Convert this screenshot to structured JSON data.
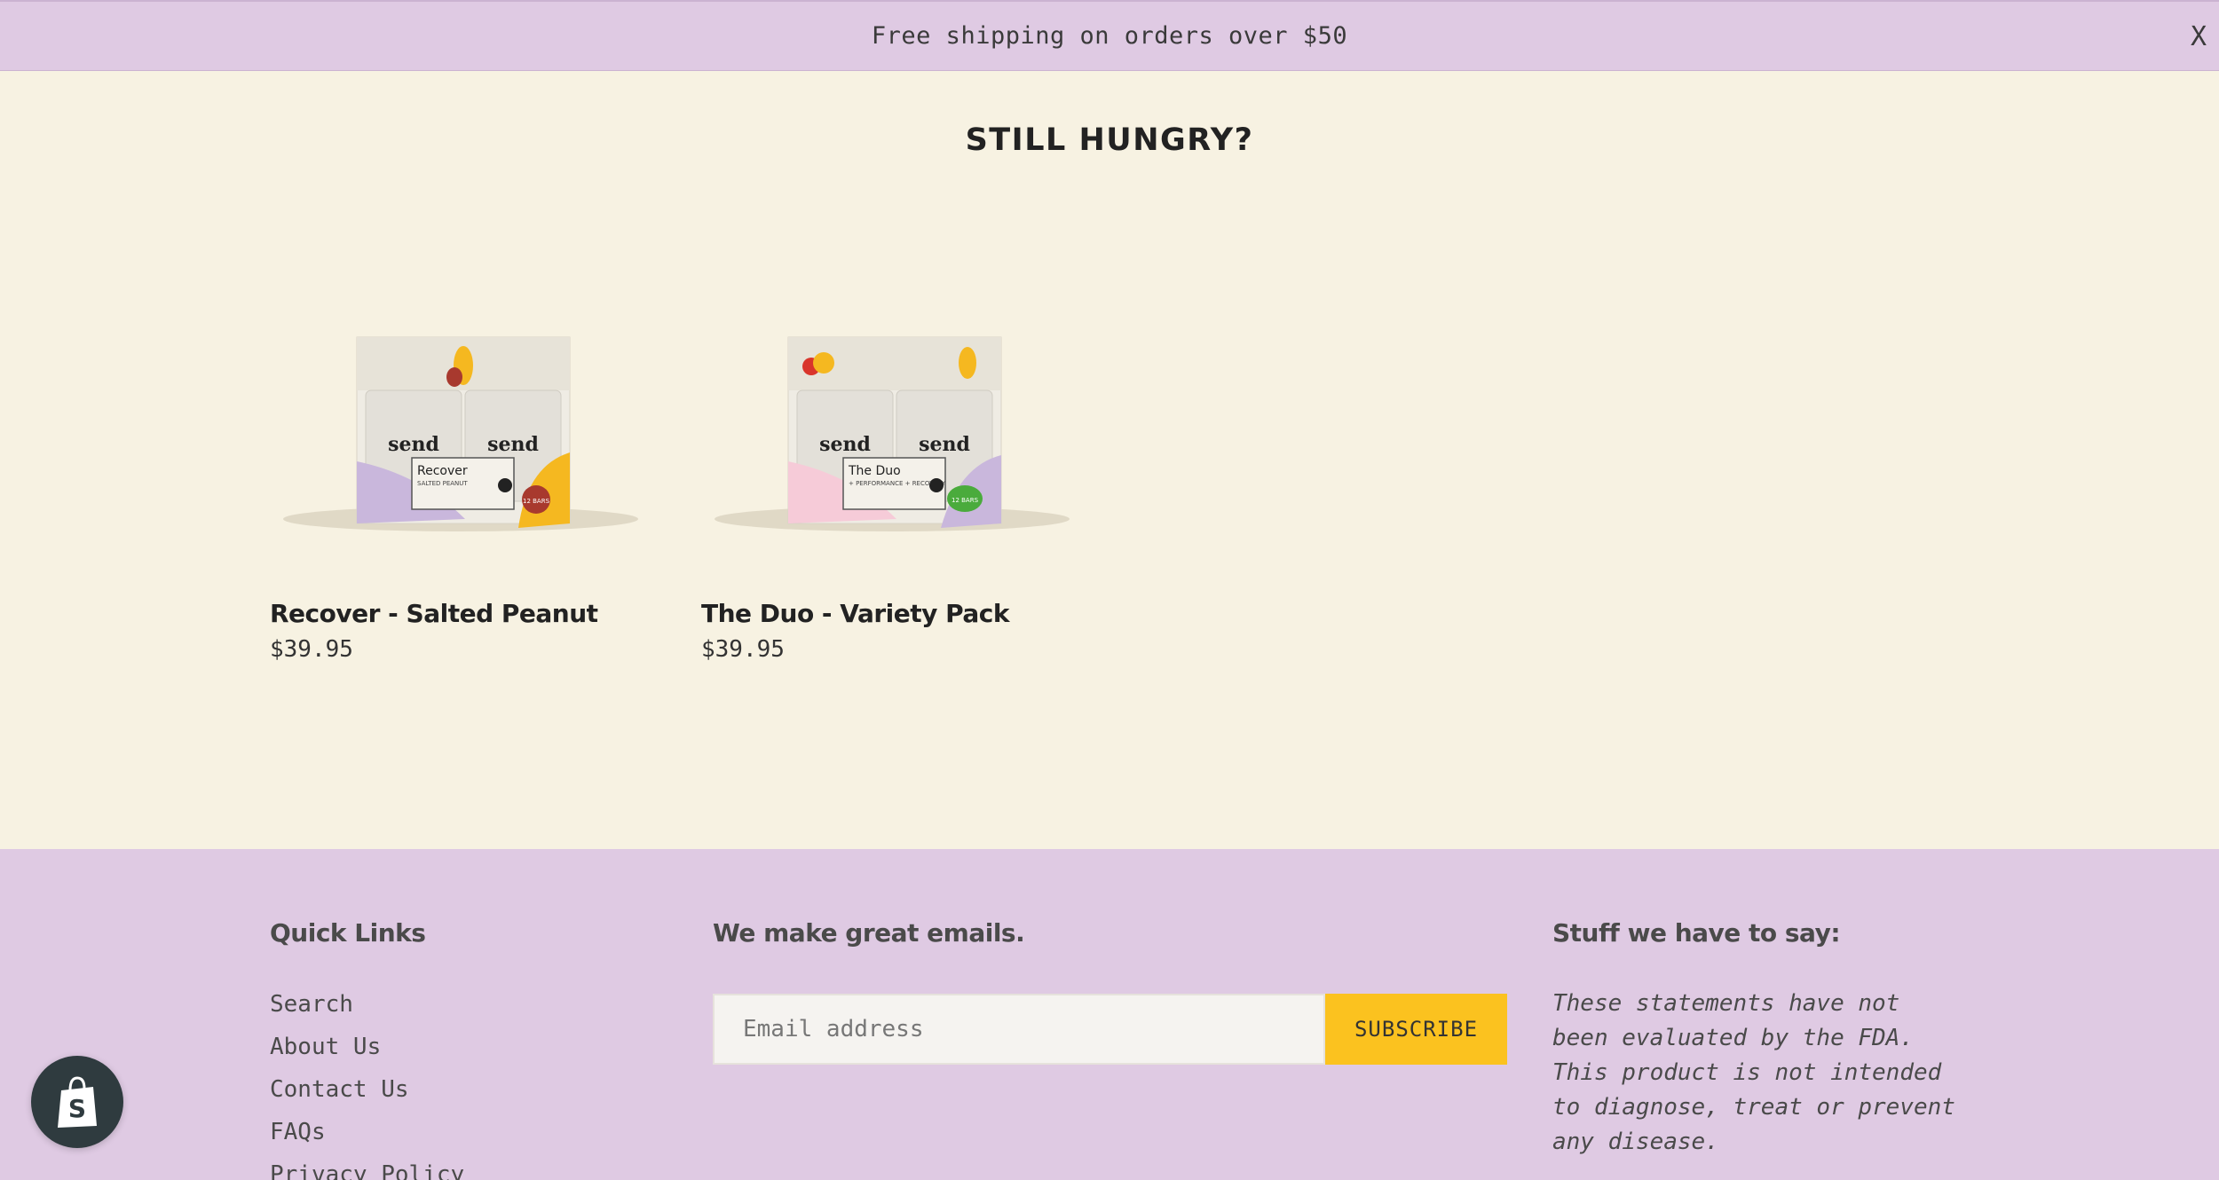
{
  "announcement": {
    "text": "Free shipping on orders over $50",
    "close_label": "X"
  },
  "section": {
    "title": "STILL HUNGRY?"
  },
  "products": [
    {
      "title": "Recover - Salted Peanut",
      "price": "$39.95",
      "box_name": "Recover",
      "box_flavor": "SALTED PEANUT",
      "brand": "send",
      "count_label": "12 BARS",
      "accent": "#c9b7dc",
      "sticker": "#f5b820",
      "badge": "#a8392e"
    },
    {
      "title": "The Duo - Variety Pack",
      "price": "$39.95",
      "box_name": "The Duo",
      "box_flavor": "+ PERFORMANCE + RECOVERY",
      "brand": "send",
      "count_label": "12 BARS",
      "accent": "#f6cbd8",
      "sticker": "#c9b7dc",
      "badge": "#4aab3c"
    }
  ],
  "footer": {
    "links_heading": "Quick Links",
    "links": [
      "Search",
      "About Us",
      "Contact Us",
      "FAQs",
      "Privacy Policy"
    ],
    "email_heading": "We make great emails.",
    "email_placeholder": "Email address",
    "subscribe_label": "SUBSCRIBE",
    "legal_heading": "Stuff we have to say:",
    "legal_text": "These statements have not been evaluated by the FDA. This product is not intended to diagnose, treat or prevent any disease."
  },
  "colors": {
    "announcement_bg": "#dfcae3",
    "page_bg": "#f7f2e2",
    "footer_bg": "#dfcae3",
    "subscribe_bg": "#fbc21f"
  },
  "icons": {
    "shop_badge": "shopify-bag-icon",
    "close": "close-icon"
  }
}
